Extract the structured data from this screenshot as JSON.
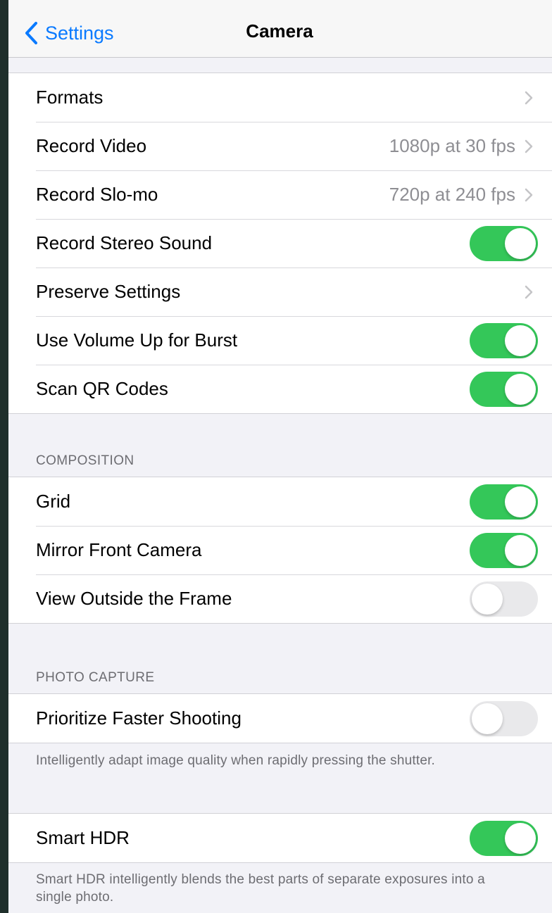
{
  "nav": {
    "back_label": "Settings",
    "title": "Camera"
  },
  "main_group": {
    "rows": [
      {
        "label": "Formats"
      },
      {
        "label": "Record Video",
        "value": "1080p at 30 fps"
      },
      {
        "label": "Record Slo-mo",
        "value": "720p at 240 fps"
      },
      {
        "label": "Record Stereo Sound",
        "toggle": true
      },
      {
        "label": "Preserve Settings"
      },
      {
        "label": "Use Volume Up for Burst",
        "toggle": true
      },
      {
        "label": "Scan QR Codes",
        "toggle": true
      }
    ]
  },
  "composition": {
    "header": "COMPOSITION",
    "rows": [
      {
        "label": "Grid",
        "toggle": true
      },
      {
        "label": "Mirror Front Camera",
        "toggle": true
      },
      {
        "label": "View Outside the Frame",
        "toggle": false
      }
    ]
  },
  "photo_capture": {
    "header": "PHOTO CAPTURE",
    "rows": [
      {
        "label": "Prioritize Faster Shooting",
        "toggle": false
      }
    ],
    "footer": "Intelligently adapt image quality when rapidly pressing the shutter."
  },
  "smart_hdr": {
    "rows": [
      {
        "label": "Smart HDR",
        "toggle": true
      }
    ],
    "footer": "Smart HDR intelligently blends the best parts of separate exposures into a single photo."
  },
  "colors": {
    "accent": "#0a7aff",
    "toggle_on": "#34c759",
    "toggle_off": "#e9e9eb",
    "background": "#f2f2f7"
  }
}
